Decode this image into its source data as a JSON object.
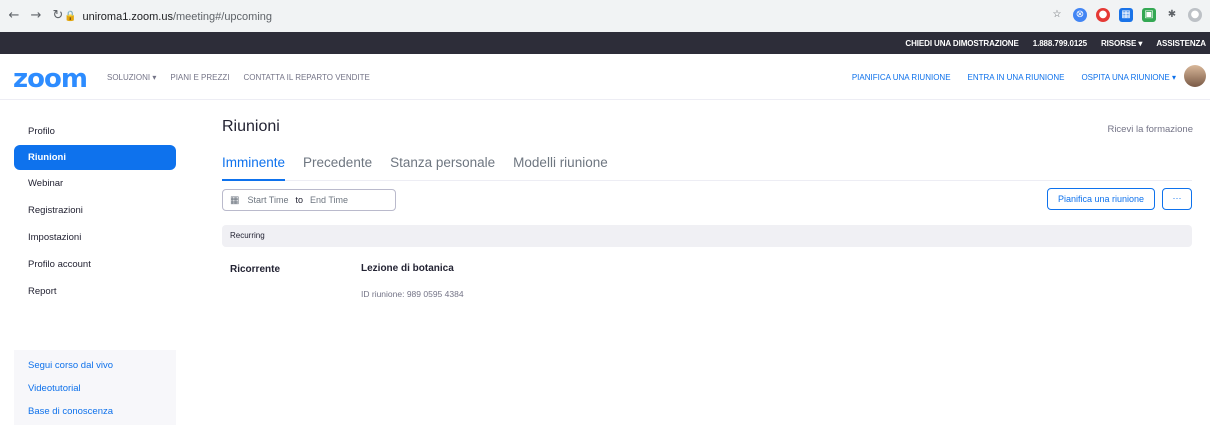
{
  "browser": {
    "back_icon": "back-arrow-icon",
    "forward_icon": "forward-arrow-icon",
    "reload_icon": "reload-icon",
    "url_domain": "uniroma1.zoom.us",
    "url_path": "/meeting#/upcoming"
  },
  "topbar": {
    "demo": "CHIEDI UNA DIMOSTRAZIONE",
    "phone": "1.888.799.0125",
    "resources": "RISORSE ▾",
    "support": "ASSISTENZA"
  },
  "nav": {
    "logo": "zoom",
    "solutions": "SOLUZIONI ▾",
    "plans": "PIANI E PREZZI",
    "sales": "CONTATTA IL REPARTO VENDITE",
    "schedule": "PIANIFICA UNA RIUNIONE",
    "join": "ENTRA IN UNA RIUNIONE",
    "host": "OSPITA UNA RIUNIONE ▾"
  },
  "sidebar": {
    "items": [
      {
        "label": "Profilo"
      },
      {
        "label": "Riunioni"
      },
      {
        "label": "Webinar"
      },
      {
        "label": "Registrazioni"
      },
      {
        "label": "Impostazioni"
      },
      {
        "label": "Profilo account"
      },
      {
        "label": "Report"
      }
    ],
    "links": [
      {
        "label": "Segui corso dal vivo"
      },
      {
        "label": "Videotutorial"
      },
      {
        "label": "Base di conoscenza"
      }
    ]
  },
  "main": {
    "title": "Riunioni",
    "training": "Ricevi la formazione",
    "tabs": [
      {
        "label": "Imminente"
      },
      {
        "label": "Precedente"
      },
      {
        "label": "Stanza personale"
      },
      {
        "label": "Modelli riunione"
      }
    ],
    "date_start": "Start Time",
    "date_to": "to",
    "date_end": "End Time",
    "schedule_button": "Pianifica una riunione",
    "more_button": "···",
    "section": "Recurring",
    "meeting": {
      "type": "Ricorrente",
      "title": "Lezione di botanica",
      "id_text": "ID riunione: 989 0595 4384"
    }
  }
}
